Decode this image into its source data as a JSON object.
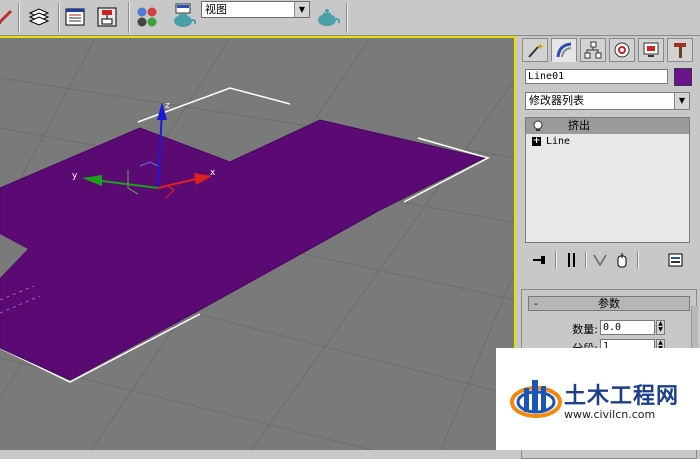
{
  "toolbar": {
    "view_select_value": "视图",
    "icons": [
      "pencil-icon",
      "layers-icon",
      "track-view-icon",
      "schematic-view-icon",
      "material-editor-icon",
      "render-setup-icon",
      "quick-render-icon"
    ]
  },
  "viewport": {
    "axis_x": "x",
    "axis_y": "y",
    "axis_z": "z",
    "object_color": "#5a0a72",
    "border_color": "#e8e000"
  },
  "panel": {
    "tabs": [
      "create-tab",
      "modify-tab",
      "hierarchy-tab",
      "motion-tab",
      "display-tab",
      "utilities-tab"
    ],
    "object_name": "Line01",
    "object_color": "#6b138e",
    "modifier_list": "修改器列表",
    "stack": [
      {
        "label": "挤出",
        "selected": true
      },
      {
        "label": "Line",
        "selected": false
      }
    ],
    "rollout_title": "参数",
    "rollout_toggle": "-",
    "params": [
      {
        "label": "数量:",
        "value": "0.0"
      },
      {
        "label": "分段:",
        "value": "1"
      }
    ]
  },
  "watermark": {
    "title": "土木工程网",
    "url": "www.civilcn.com"
  }
}
